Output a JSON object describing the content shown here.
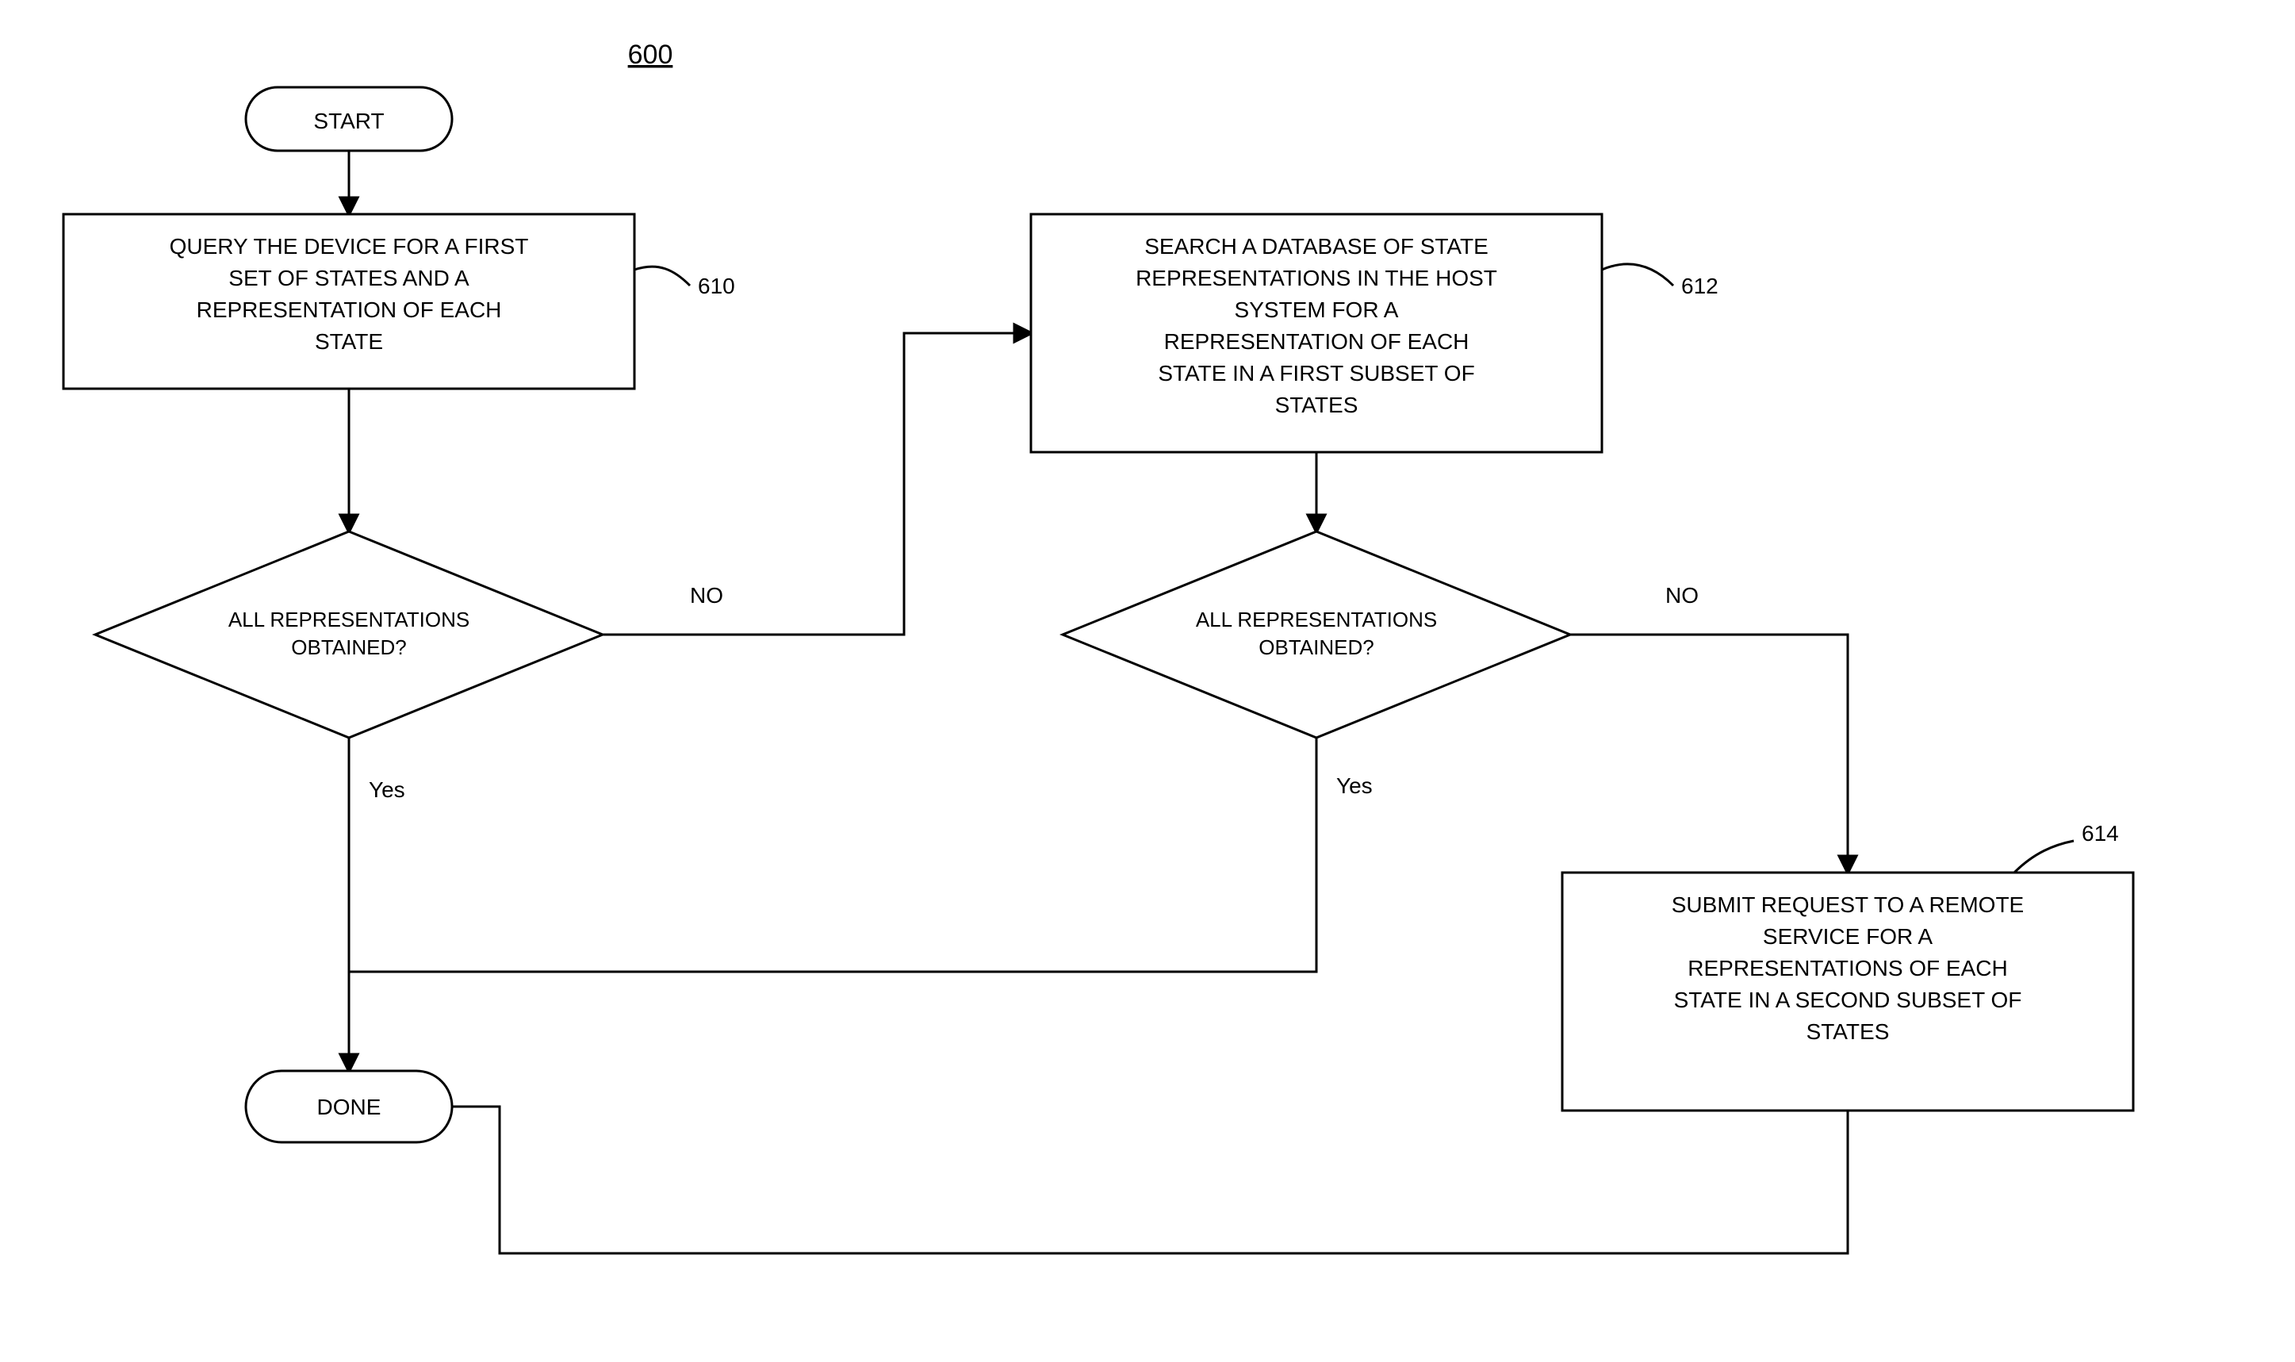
{
  "figure_label": "600",
  "terminals": {
    "start": "START",
    "done": "DONE"
  },
  "blocks": {
    "b610": {
      "ref": "610",
      "lines": [
        "QUERY THE DEVICE FOR A FIRST",
        "SET OF STATES AND A",
        "REPRESENTATION OF EACH",
        "STATE"
      ]
    },
    "b612": {
      "ref": "612",
      "lines": [
        "SEARCH A DATABASE OF STATE",
        "REPRESENTATIONS IN THE HOST",
        "SYSTEM FOR A",
        "REPRESENTATION OF EACH",
        "STATE IN A FIRST SUBSET OF",
        "STATES"
      ]
    },
    "b614": {
      "ref": "614",
      "lines": [
        "SUBMIT REQUEST TO A REMOTE",
        "SERVICE FOR A",
        "REPRESENTATIONS OF EACH",
        "STATE IN A SECOND SUBSET OF",
        "STATES"
      ]
    }
  },
  "decisions": {
    "d1": {
      "lines": [
        "ALL REPRESENTATIONS",
        "OBTAINED?"
      ]
    },
    "d2": {
      "lines": [
        "ALL REPRESENTATIONS",
        "OBTAINED?"
      ]
    }
  },
  "labels": {
    "yes": "Yes",
    "no": "NO"
  }
}
